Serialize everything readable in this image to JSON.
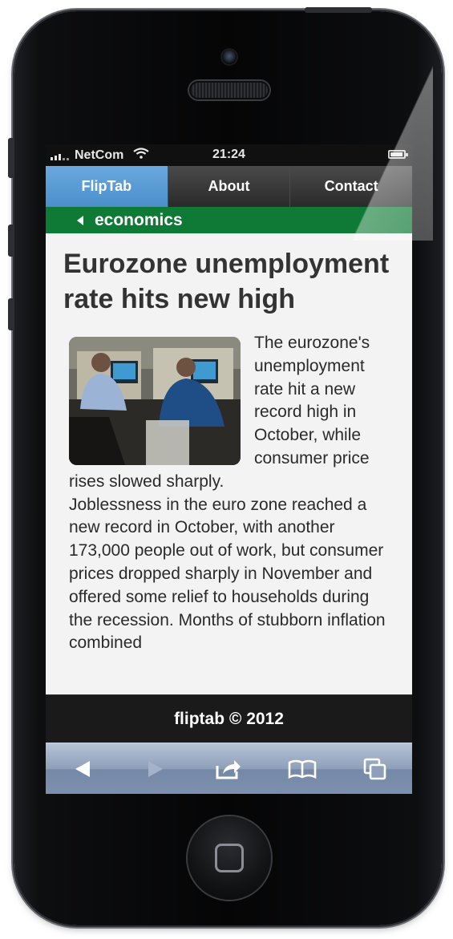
{
  "status": {
    "carrier": "NetCom",
    "time": "21:24"
  },
  "nav": {
    "tabs": [
      {
        "label": "FlipTab",
        "active": true
      },
      {
        "label": "About",
        "active": false
      },
      {
        "label": "Contact",
        "active": false
      }
    ]
  },
  "breadcrumb": {
    "label": "economics"
  },
  "article": {
    "headline": "Eurozone unemployment rate hits new high",
    "lead": "The eurozone's unemployment rate hit a new record high in October, while consumer price rises slowed sharply.",
    "paragraph": "Joblessness in the euro zone reached a new record in October, with another 173,000 people out of work, but consumer prices dropped sharply in November and offered some relief to households during the recession. Months of stubborn inflation combined"
  },
  "footer": {
    "text": "fliptab © 2012"
  },
  "toolbar": {
    "icons": [
      "back-arrow-icon",
      "forward-arrow-icon",
      "share-icon",
      "bookmarks-icon",
      "tabs-icon"
    ]
  },
  "colors": {
    "tab_active": "#5b9bd5",
    "breadcrumb_bar": "#0f7a35",
    "toolbar": "#8d9fb9"
  }
}
